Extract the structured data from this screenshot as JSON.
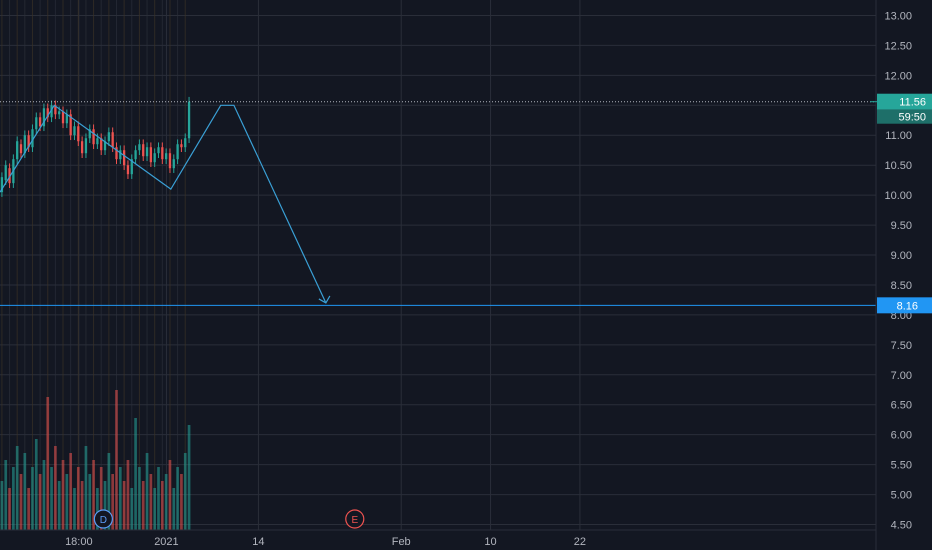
{
  "chart_data": {
    "type": "candlestick",
    "y_ticks": [
      "13.00",
      "12.50",
      "12.00",
      "11.50",
      "11.00",
      "10.50",
      "10.00",
      "9.50",
      "9.00",
      "8.50",
      "8.00",
      "7.50",
      "7.00",
      "6.50",
      "6.00",
      "5.50",
      "5.00",
      "4.50"
    ],
    "ylim": [
      4.4,
      13.25
    ],
    "x_ticks": [
      {
        "label": "18:00",
        "x": 0.09
      },
      {
        "label": "2021",
        "x": 0.19
      },
      {
        "label": "14",
        "x": 0.295
      },
      {
        "label": "Feb",
        "x": 0.458
      },
      {
        "label": "10",
        "x": 0.56
      },
      {
        "label": "22",
        "x": 0.662
      }
    ],
    "last_price": {
      "value": 11.56,
      "label": "11.56",
      "countdown": "59:50",
      "color": "#26a69a"
    },
    "target_line": {
      "value": 8.16,
      "label": "8.16",
      "color": "#2196f3"
    },
    "zigzag": [
      {
        "x": 0.0,
        "y": 10.05
      },
      {
        "x": 0.062,
        "y": 11.5
      },
      {
        "x": 0.195,
        "y": 10.1
      },
      {
        "x": 0.252,
        "y": 11.5
      },
      {
        "x": 0.267,
        "y": 11.5
      },
      {
        "x": 0.372,
        "y": 8.2
      }
    ],
    "candles": [
      [
        10.05,
        10.3
      ],
      [
        10.25,
        10.5
      ],
      [
        10.45,
        10.2
      ],
      [
        10.2,
        10.6
      ],
      [
        10.6,
        10.9
      ],
      [
        10.85,
        10.7
      ],
      [
        10.7,
        11.0
      ],
      [
        11.0,
        10.8
      ],
      [
        10.8,
        11.1
      ],
      [
        11.1,
        11.3
      ],
      [
        11.3,
        11.15
      ],
      [
        11.15,
        11.45
      ],
      [
        11.45,
        11.3
      ],
      [
        11.3,
        11.5
      ],
      [
        11.5,
        11.35
      ],
      [
        11.35,
        11.4
      ],
      [
        11.4,
        11.2
      ],
      [
        11.2,
        11.35
      ],
      [
        11.35,
        11.0
      ],
      [
        11.0,
        11.15
      ],
      [
        11.15,
        10.9
      ],
      [
        10.9,
        10.7
      ],
      [
        10.7,
        10.95
      ],
      [
        10.95,
        11.1
      ],
      [
        11.1,
        10.85
      ],
      [
        10.85,
        10.95
      ],
      [
        10.95,
        10.75
      ],
      [
        10.75,
        10.9
      ],
      [
        10.9,
        11.05
      ],
      [
        11.05,
        10.8
      ],
      [
        10.8,
        10.6
      ],
      [
        10.6,
        10.75
      ],
      [
        10.75,
        10.5
      ],
      [
        10.5,
        10.35
      ],
      [
        10.35,
        10.6
      ],
      [
        10.6,
        10.75
      ],
      [
        10.75,
        10.85
      ],
      [
        10.85,
        10.65
      ],
      [
        10.65,
        10.8
      ],
      [
        10.8,
        10.55
      ],
      [
        10.55,
        10.7
      ],
      [
        10.7,
        10.8
      ],
      [
        10.8,
        10.6
      ],
      [
        10.6,
        10.7
      ],
      [
        10.7,
        10.45
      ],
      [
        10.45,
        10.6
      ],
      [
        10.6,
        10.85
      ],
      [
        10.85,
        10.8
      ],
      [
        10.8,
        10.95
      ],
      [
        10.95,
        11.56
      ]
    ],
    "volumes": [
      0.35,
      0.5,
      0.3,
      0.45,
      0.6,
      0.4,
      0.55,
      0.3,
      0.45,
      0.65,
      0.4,
      0.5,
      0.95,
      0.45,
      0.6,
      0.35,
      0.5,
      0.4,
      0.55,
      0.3,
      0.45,
      0.35,
      0.6,
      0.4,
      0.5,
      0.3,
      0.45,
      0.35,
      0.55,
      0.4,
      1.0,
      0.45,
      0.35,
      0.5,
      0.3,
      0.8,
      0.45,
      0.35,
      0.55,
      0.4,
      0.3,
      0.45,
      0.35,
      0.4,
      0.5,
      0.3,
      0.45,
      0.4,
      0.55,
      0.75
    ]
  },
  "markers": [
    {
      "label": "D",
      "color": "#5b9cf6",
      "x": 0.118
    },
    {
      "label": "E",
      "color": "#ef5350",
      "x": 0.405
    }
  ],
  "colors": {
    "up": "#26a69a",
    "down": "#ef5350",
    "grid": "#2a2e39",
    "line": "#3aa0d6"
  }
}
